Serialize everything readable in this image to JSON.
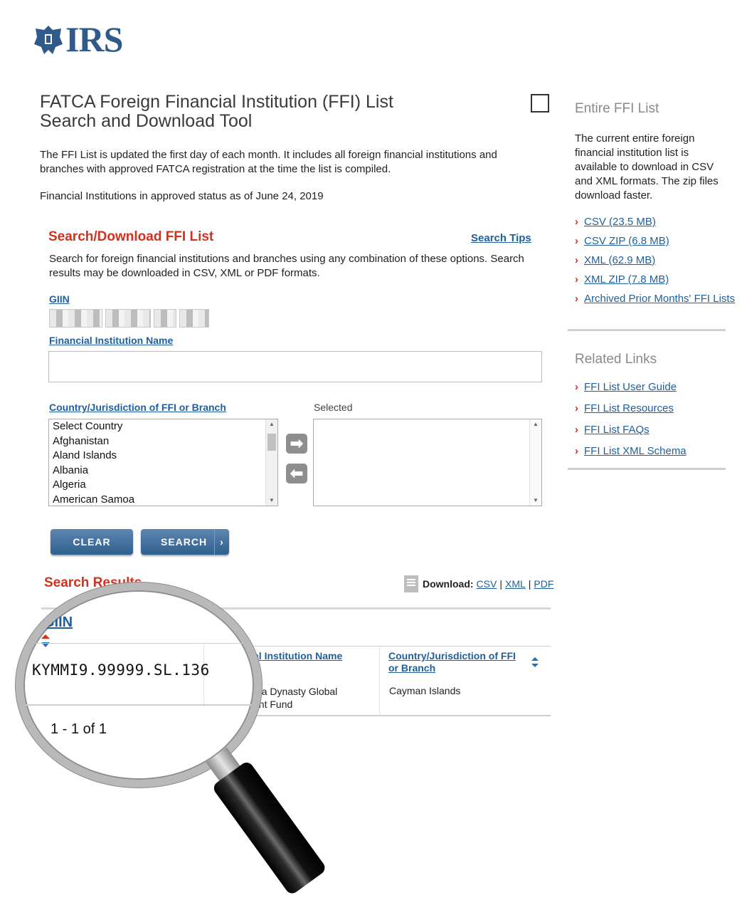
{
  "logo": {
    "text": "IRS"
  },
  "page": {
    "title_line1": "FATCA Foreign Financial Institution (FFI) List",
    "title_line2": "Search and Download Tool",
    "description": "The FFI List is updated the first day of each month. It includes all foreign financial institutions and branches with approved FATCA registration at the time the list is compiled.",
    "status_date": "Financial Institutions in approved status as of June 24, 2019"
  },
  "search": {
    "heading": "Search/Download FFI List",
    "tips_link": "Search Tips",
    "description": "Search for foreign financial institutions and branches using any combination of these options. Search results may be downloaded in CSV, XML or PDF formats.",
    "giin_label": "GIIN",
    "fi_name_label": "Financial Institution Name",
    "fi_name_value": "",
    "country_label": "Country/Jurisdiction of FFI or Branch",
    "selected_label": "Selected",
    "countries": [
      "Select Country",
      "Afghanistan",
      "Aland Islands",
      "Albania",
      "Algeria",
      "American Samoa"
    ],
    "move_right_icon": "arrow-right-icon",
    "move_left_icon": "arrow-left-icon",
    "clear_label": "CLEAR",
    "search_label": "SEARCH",
    "search_chevron": "›"
  },
  "results": {
    "heading": "Search Results",
    "download_label": "Download:",
    "download_links": [
      "CSV",
      "XML",
      "PDF"
    ],
    "columns": {
      "giin": "GIIN",
      "name": "Financial Institution Name",
      "country": "Country/Jurisdiction of FFI or Branch"
    },
    "rows": [
      {
        "giin": "KYMMI9.99999.SL.136",
        "name": "New China Dynasty Global Investment Fund",
        "country": "Cayman Islands"
      }
    ],
    "pager": "1 - 1 of 1"
  },
  "sidebar": {
    "entire_heading": "Entire FFI List",
    "entire_desc": "The current entire foreign financial institution list is available to download in CSV and XML formats. The zip files download faster.",
    "download_links": [
      "CSV (23.5 MB)",
      "CSV ZIP (6.8 MB)",
      "XML (62.9 MB)",
      "XML ZIP (7.8 MB)",
      "Archived Prior Months' FFI Lists"
    ],
    "related_heading": "Related Links",
    "related_links": [
      "FFI List User Guide",
      "FFI List Resources",
      "FFI List FAQs",
      "FFI List XML Schema"
    ]
  },
  "colors": {
    "accent_red": "#d0321e",
    "link_blue": "#1f5f9e",
    "irs_blue": "#2f5a8a",
    "button_blue": "#2f5f8f"
  }
}
